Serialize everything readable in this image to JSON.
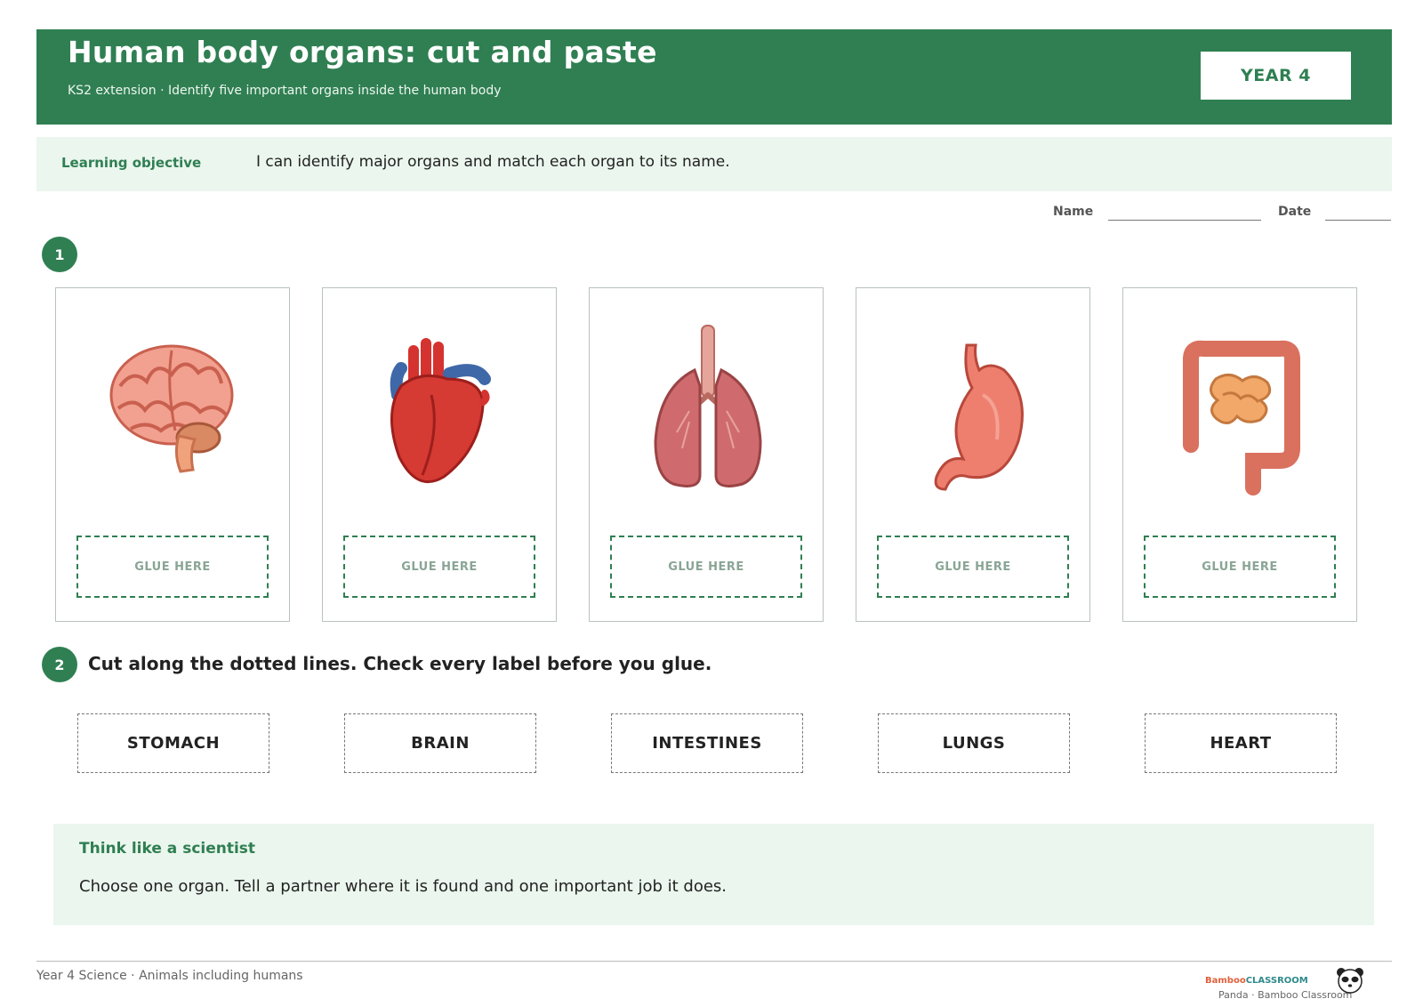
{
  "header": {
    "title": "Human body organs: cut and paste",
    "subtitle": "KS2 extension · Identify five important organs inside the human body",
    "year_badge": "YEAR 4"
  },
  "objective": {
    "label": "Learning objective",
    "text": "I can identify major organs and match each organ to its name."
  },
  "student": {
    "name_label": "Name",
    "date_label": "Date"
  },
  "steps": {
    "one": "1",
    "two": "2",
    "two_text": "Cut along the dotted lines. Check every label before you glue."
  },
  "cards": [
    {
      "icon": "brain-icon",
      "glue": "GLUE HERE"
    },
    {
      "icon": "heart-icon",
      "glue": "GLUE HERE"
    },
    {
      "icon": "lungs-icon",
      "glue": "GLUE HERE"
    },
    {
      "icon": "stomach-icon",
      "glue": "GLUE HERE"
    },
    {
      "icon": "intestines-icon",
      "glue": "GLUE HERE"
    }
  ],
  "labels": [
    "STOMACH",
    "BRAIN",
    "INTESTINES",
    "LUNGS",
    "HEART"
  ],
  "scientist": {
    "heading": "Think like a scientist",
    "text": "Choose one organ. Tell a partner where it is found and one important job it does."
  },
  "footer": {
    "left": "Year 4 Science · Animals including humans",
    "brand_a": "Bamboo",
    "brand_b": "CLASSROOM",
    "brand_sub": "Panda · Bamboo Classroom"
  },
  "colors": {
    "accent": "#2f7f52",
    "panel": "#ebf6ee"
  }
}
